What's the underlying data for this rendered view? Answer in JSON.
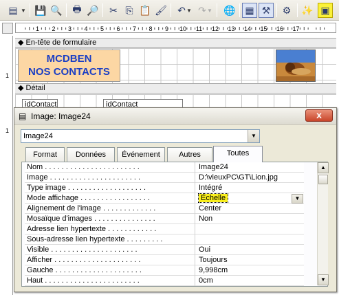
{
  "header_section": {
    "label": "En-tête de formulaire",
    "title_line1": "MCDBEN",
    "title_line2": "NOS CONTACTS"
  },
  "detail_section": {
    "label": "Détail",
    "field1": "idContact",
    "field2": "idContact"
  },
  "ruler_ticks": [
    "1",
    "2",
    "3",
    "4",
    "5",
    "6",
    "7",
    "8",
    "9",
    "10",
    "11",
    "12",
    "13",
    "14",
    "15",
    "16",
    "17"
  ],
  "vruler_ticks": [
    "1",
    "1"
  ],
  "dialog": {
    "title": "Image: Image24",
    "object": "Image24",
    "close": "x",
    "tabs": [
      "Format",
      "Données",
      "Événement",
      "Autres",
      "Toutes"
    ],
    "active_tab": "Toutes",
    "properties": [
      {
        "label": "Nom . . . . . . . . . . . . . . . . . . . . . . .",
        "value": "Image24"
      },
      {
        "label": "Image . . . . . . . . . . . . . . . . . . . . . .",
        "value": "D:\\vieuxPC\\GT\\Lion.jpg"
      },
      {
        "label": "Type image . . . . . . . . . . . . . . . . . . .",
        "value": "Intégré"
      },
      {
        "label": "Mode affichage . . . . . . . . . . . . . . . . .",
        "value": "Échelle"
      },
      {
        "label": "Alignement de l'image . . . . . . . . . . . . .",
        "value": "Center"
      },
      {
        "label": "Mosaïque d'images . . . . . . . . . . . . . . .",
        "value": "Non"
      },
      {
        "label": "Adresse lien hypertexte . . . . . . . . . . . .",
        "value": ""
      },
      {
        "label": "Sous-adresse lien hypertexte . . . . . . . . .",
        "value": ""
      },
      {
        "label": "Visible . . . . . . . . . . . . . . . . . . . . .",
        "value": "Oui"
      },
      {
        "label": "Afficher . . . . . . . . . . . . . . . . . . . . .",
        "value": "Toujours"
      },
      {
        "label": "Gauche . . . . . . . . . . . . . . . . . . . . .",
        "value": "9,998cm"
      },
      {
        "label": "Haut . . . . . . . . . . . . . . . . . . . . . . .",
        "value": "0cm"
      }
    ]
  },
  "colors": {
    "accent_yellow": "#f9ef1c",
    "header_fill": "#fcd7a4",
    "header_text": "#1a3ec4",
    "close_red": "#c9452a"
  },
  "toolbar_icons": [
    "form-view-icon",
    "save-icon",
    "search-file-icon",
    "print-icon",
    "print-preview-icon",
    "spelling-icon",
    "cut-icon",
    "copy-icon",
    "paste-icon",
    "format-painter-icon",
    "undo-icon",
    "redo-icon",
    "hyperlink-icon",
    "field-list-icon",
    "toolbox-icon",
    "autoformat-icon",
    "code-icon",
    "properties-icon"
  ]
}
